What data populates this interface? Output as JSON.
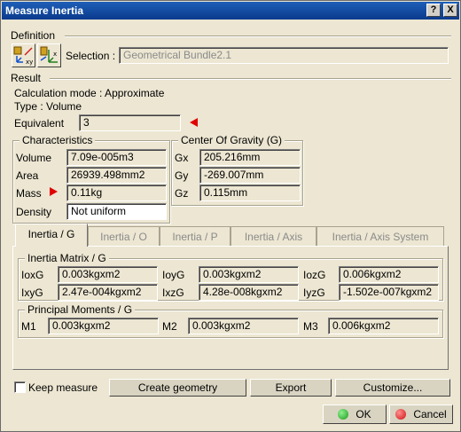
{
  "window": {
    "title": "Measure Inertia",
    "help_btn": "?",
    "close_btn": "X"
  },
  "definition": {
    "label": "Definition",
    "selection_label": "Selection :",
    "selection_value": "Geometrical Bundle2.1"
  },
  "result": {
    "label": "Result",
    "calc_mode": "Calculation mode :  Approximate",
    "type": "Type :  Volume",
    "equivalent_label": "Equivalent",
    "equivalent_value": "3"
  },
  "characteristics": {
    "title": "Characteristics",
    "volume_label": "Volume",
    "volume_value": "7.09e-005m3",
    "area_label": "Area",
    "area_value": "26939.498mm2",
    "mass_label": "Mass",
    "mass_value": "0.11kg",
    "density_label": "Density",
    "density_value": "Not uniform"
  },
  "cog": {
    "title": "Center Of Gravity (G)",
    "gx_label": "Gx",
    "gx_value": "205.216mm",
    "gy_label": "Gy",
    "gy_value": "-269.007mm",
    "gz_label": "Gz",
    "gz_value": "0.115mm"
  },
  "tabs": [
    "Inertia / G",
    "Inertia / O",
    "Inertia / P",
    "Inertia / Axis",
    "Inertia / Axis System"
  ],
  "matrix": {
    "title": "Inertia Matrix / G",
    "ioxg_label": "IoxG",
    "ioxg_value": "0.003kgxm2",
    "ioyg_label": "IoyG",
    "ioyg_value": "0.003kgxm2",
    "iozg_label": "IozG",
    "iozg_value": "0.006kgxm2",
    "ixyg_label": "IxyG",
    "ixyg_value": "2.47e-004kgxm2",
    "ixzg_label": "IxzG",
    "ixzg_value": "4.28e-008kgxm2",
    "iyzg_label": "IyzG",
    "iyzg_value": "-1.502e-007kgxm2"
  },
  "principal": {
    "title": "Principal Moments / G",
    "m1_label": "M1",
    "m1_value": "0.003kgxm2",
    "m2_label": "M2",
    "m2_value": "0.003kgxm2",
    "m3_label": "M3",
    "m3_value": "0.006kgxm2"
  },
  "footer": {
    "keep_measure": "Keep measure",
    "create_geometry": "Create geometry",
    "export": "Export",
    "customize": "Customize...",
    "ok": "OK",
    "cancel": "Cancel"
  },
  "colors": {
    "title_bar": "#0a3a8c",
    "arrow": "#e00000",
    "ok_dot": "#1a9a1a",
    "cancel_dot": "#d01010"
  }
}
